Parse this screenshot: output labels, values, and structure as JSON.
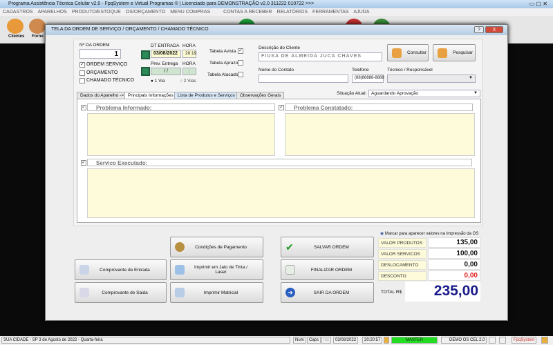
{
  "app": {
    "title": "Programa Assistência Técnica Celular v2.0 - FpqSystem e Virtual Programas ® | Licenciado para  DEMONSTRAÇÃO v2.0 311222 010722 >>>",
    "menu": [
      "CADASTROS",
      "APARELHOS",
      "PRODUTO/ESTOQUE",
      "OS/ORÇAMENTO",
      "MENU COMPRAS",
      "CONTAS A RECEBER",
      "RELATÓRIOS",
      "FERRAMENTAS",
      "AJUDA"
    ],
    "toolbar": [
      "Clientes",
      "Forne"
    ]
  },
  "dialog": {
    "title": "TELA DA ORDEM DE SERVIÇO / ORÇAMENTO / CHAMADO TÉCNICO",
    "help": "?",
    "close": "X",
    "order_label": "Nº DA ORDEM",
    "order_number": "1",
    "types": [
      {
        "label": "ORDEM SERVIÇO",
        "checked": true
      },
      {
        "label": "ORÇAMENTO",
        "checked": false
      },
      {
        "label": "CHAMADO TÉCNICO",
        "checked": false
      }
    ],
    "dt_entrada_label": "DT ENTRADA",
    "hora_label": "HORA",
    "dt_entrada": "03/08/2022",
    "hora_entrada": "20:19",
    "prev_entrega_label": "Prev. Entrega",
    "hora2_label": "HORA",
    "prev_entrega": "/ /",
    "hora_prev": ":",
    "vias": [
      {
        "label": "1 Via",
        "selected": true
      },
      {
        "label": "2 Vias",
        "selected": false
      }
    ],
    "tabelas": [
      {
        "label": "Tabela Avista",
        "checked": true
      },
      {
        "label": "Tabela Aprazo",
        "checked": false
      },
      {
        "label": "Tabela Atacado",
        "checked": false
      }
    ],
    "cliente_label": "Descrição do Cliente",
    "cliente": "FIUSA DE ALMEIDA JUCA CHAVES",
    "consultar": "Consultar",
    "pesquisar": "Pesquisar",
    "contato_label": "Nome do Contato",
    "contato": "",
    "telefone_label": "Telefone",
    "telefone": "(88)88888-8888",
    "tecnico_label": "Técnico / Responsável",
    "tecnico": "",
    "tabs": [
      "Dados do Aparelho ->",
      "Principais Informações ->",
      "Lista de Produtos e Serviços ->",
      "Observações Gerais"
    ],
    "situacao_label": "Situação Atual:",
    "situacao": "Aguardando Aprovação",
    "problema_informado": "Problema Informado:",
    "problema_constatado": "Problema Constatado:",
    "servico_executado": "Servico Executado:",
    "buttons": {
      "pagamento": "Condições de Pagamento",
      "salvar": "SALVAR ORDEM",
      "entrada": "Comprovante de Entrada",
      "jato": "Imprimir em Jato de Tinta / Laser",
      "finalizar": "FINALIZAR ORDEM",
      "saida": "Comprovante de Saida",
      "matricial": "Imprimir Matricial",
      "sair": "SAIR DA ORDEM"
    },
    "marcar": "Marcar para aparecer valores na Impressão da OS",
    "summary": [
      {
        "label": "VALOR PRODUTOS",
        "value": "135,00"
      },
      {
        "label": "VALOR SERVICOS",
        "value": "100,00"
      },
      {
        "label": "DESLOCAMENTO",
        "value": "0,00"
      },
      {
        "label": "DESCONTO",
        "value": "0,00"
      }
    ],
    "total_label": "TOTAL R$",
    "total": "235,00"
  },
  "status": {
    "city": "SUA CIDADE - SP  3 de Agosto de 2022 - Quarta-feira",
    "num": "Num",
    "caps": "Caps",
    "ins": "Ins",
    "date": "03/08/2022",
    "time": "20:20:57",
    "user": "MASTER",
    "version": "DEMO OS CEL 2.0",
    "brand": "FpqSystem"
  },
  "colors": {
    "desconto": "#e02020",
    "total": "#1a1a8a",
    "user_bar": "#22dd22"
  }
}
